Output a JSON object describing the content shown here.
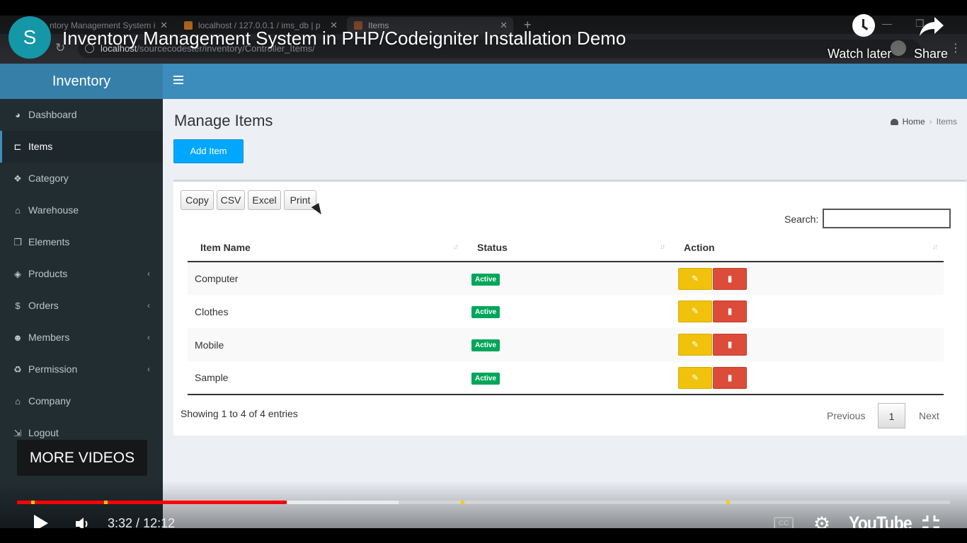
{
  "browser": {
    "tabs": [
      {
        "label": "ntory Management System i"
      },
      {
        "label": "localhost / 127.0.0.1 / ims_db | p"
      },
      {
        "label": "Items"
      }
    ],
    "new_tab": "+",
    "url_host": "localhost",
    "url_path": "/sourcecodester/inventory/Controller_Items/"
  },
  "sidebar": {
    "brand": "Inventory",
    "items": [
      {
        "label": "Dashboard",
        "icon": "dashboard-icon",
        "glyph": "◕"
      },
      {
        "label": "Items",
        "icon": "cart-icon",
        "glyph": "⊏"
      },
      {
        "label": "Category",
        "icon": "cubes-icon",
        "glyph": "❖"
      },
      {
        "label": "Warehouse",
        "icon": "bank-icon",
        "glyph": "⌂"
      },
      {
        "label": "Elements",
        "icon": "copy-icon",
        "glyph": "❐"
      },
      {
        "label": "Products",
        "icon": "cube-icon",
        "glyph": "◈",
        "chevron": "‹"
      },
      {
        "label": "Orders",
        "icon": "dollar-icon",
        "glyph": "$",
        "chevron": "‹"
      },
      {
        "label": "Members",
        "icon": "users-icon",
        "glyph": "☻",
        "chevron": "‹"
      },
      {
        "label": "Permission",
        "icon": "recycle-icon",
        "glyph": "♻",
        "chevron": "‹"
      },
      {
        "label": "Company",
        "icon": "bank-icon",
        "glyph": "⌂"
      },
      {
        "label": "Logout",
        "icon": "sign-out-icon",
        "glyph": "⇲"
      }
    ]
  },
  "page": {
    "title": "Manage Items",
    "breadcrumb_home": "Home",
    "breadcrumb_sep": "›",
    "breadcrumb_current": "Items",
    "add_button": "Add Item"
  },
  "datatable": {
    "export_buttons": [
      "Copy",
      "CSV",
      "Excel",
      "Print"
    ],
    "search_label": "Search:",
    "search_value": "",
    "columns": [
      "Item Name",
      "Status",
      "Action"
    ],
    "sort_glyph": "↓↑",
    "edit_glyph": "✎",
    "delete_glyph": "▮",
    "rows": [
      {
        "name": "Computer",
        "status": "Active"
      },
      {
        "name": "Clothes",
        "status": "Active"
      },
      {
        "name": "Mobile",
        "status": "Active"
      },
      {
        "name": "Sample",
        "status": "Active"
      }
    ],
    "info": "Showing 1 to 4 of 4 entries",
    "prev": "Previous",
    "page": "1",
    "next": "Next"
  },
  "youtube": {
    "avatar_letter": "S",
    "title": "Inventory Management System in PHP/Codeigniter Installation Demo",
    "watch_later": "Watch later",
    "share": "Share",
    "more_videos": "MORE VIDEOS",
    "time_current": "3:32",
    "time_total": "12:12",
    "progress_played": 0.289,
    "progress_buffered": 0.409,
    "chapter_marks": [
      0.015,
      0.093,
      0.476,
      0.76
    ],
    "logo": "YouTube",
    "cc": "CC",
    "accent": "#ff0000"
  }
}
